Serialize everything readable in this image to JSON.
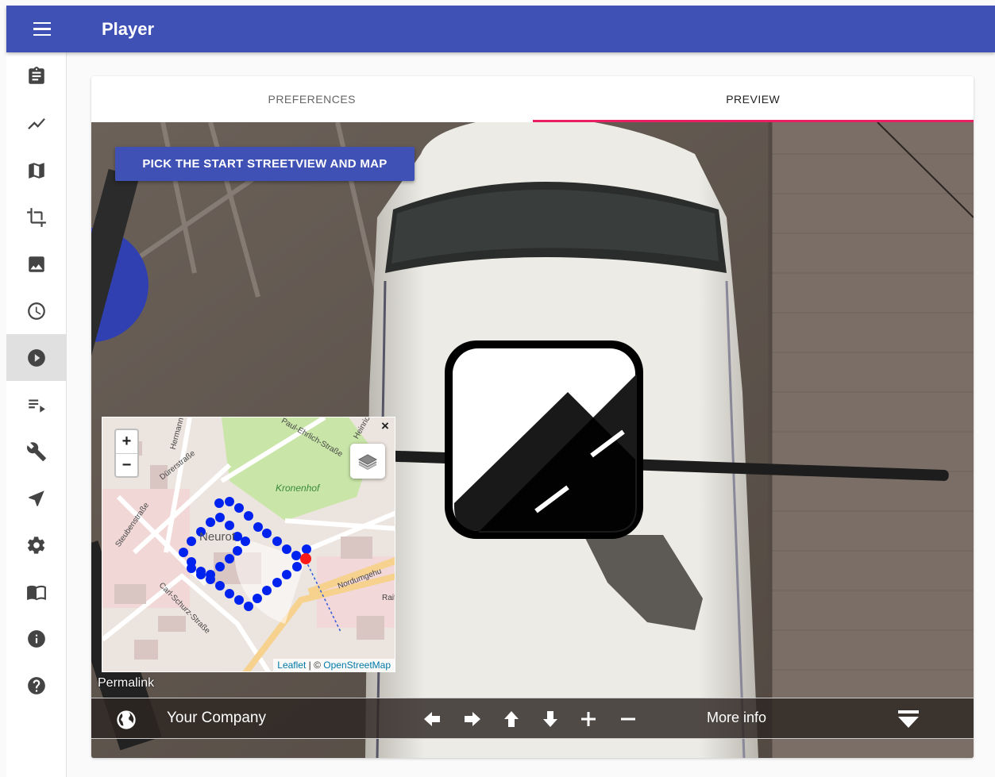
{
  "app": {
    "title": "Player"
  },
  "sidebar": {
    "items": [
      {
        "icon": "clipboard-icon"
      },
      {
        "icon": "chart-line-icon"
      },
      {
        "icon": "map-icon"
      },
      {
        "icon": "crop-icon"
      },
      {
        "icon": "image-icon"
      },
      {
        "icon": "clock-icon"
      },
      {
        "icon": "play-circle-icon",
        "active": true
      },
      {
        "icon": "playlist-icon"
      },
      {
        "icon": "wrench-icon"
      },
      {
        "icon": "navigation-icon"
      },
      {
        "icon": "gear-icon"
      },
      {
        "icon": "book-open-icon"
      },
      {
        "icon": "info-icon"
      },
      {
        "icon": "help-icon"
      }
    ]
  },
  "tabs": [
    {
      "label": "PREFERENCES",
      "active": false
    },
    {
      "label": "PREVIEW",
      "active": true
    }
  ],
  "viewer": {
    "pick_button_label": "PICK THE START STREETVIEW AND MAP",
    "permalink_label": "Permalink"
  },
  "minimap": {
    "zoom_in": "+",
    "zoom_out": "−",
    "close": "×",
    "attribution_leaflet": "Leaflet",
    "attribution_sep": " | © ",
    "attribution_osm": "OpenStreetMap",
    "labels": {
      "hermann": "Hermann-B",
      "durer": "Dürerstraße",
      "paul": "Paul-Ehrlich-Straße",
      "heinrich": "Heinrich",
      "kronenhof": "Kronenhof",
      "neurot": "Neurot",
      "steuben": "Steubenstraße",
      "carl": "Carl-Schurz-Straße",
      "nordum": "Nordumgehu",
      "raif": "Raif"
    }
  },
  "controlbar": {
    "company": "Your Company",
    "more_info": "More info",
    "icons": [
      "arrow-left-icon",
      "arrow-right-icon",
      "arrow-up-icon",
      "arrow-down-icon",
      "plus-icon",
      "minus-icon"
    ]
  },
  "colors": {
    "primary": "#3f51b5",
    "accent": "#e91e63",
    "path_dot": "#0022ee",
    "current_dot": "#ff1a1a"
  }
}
